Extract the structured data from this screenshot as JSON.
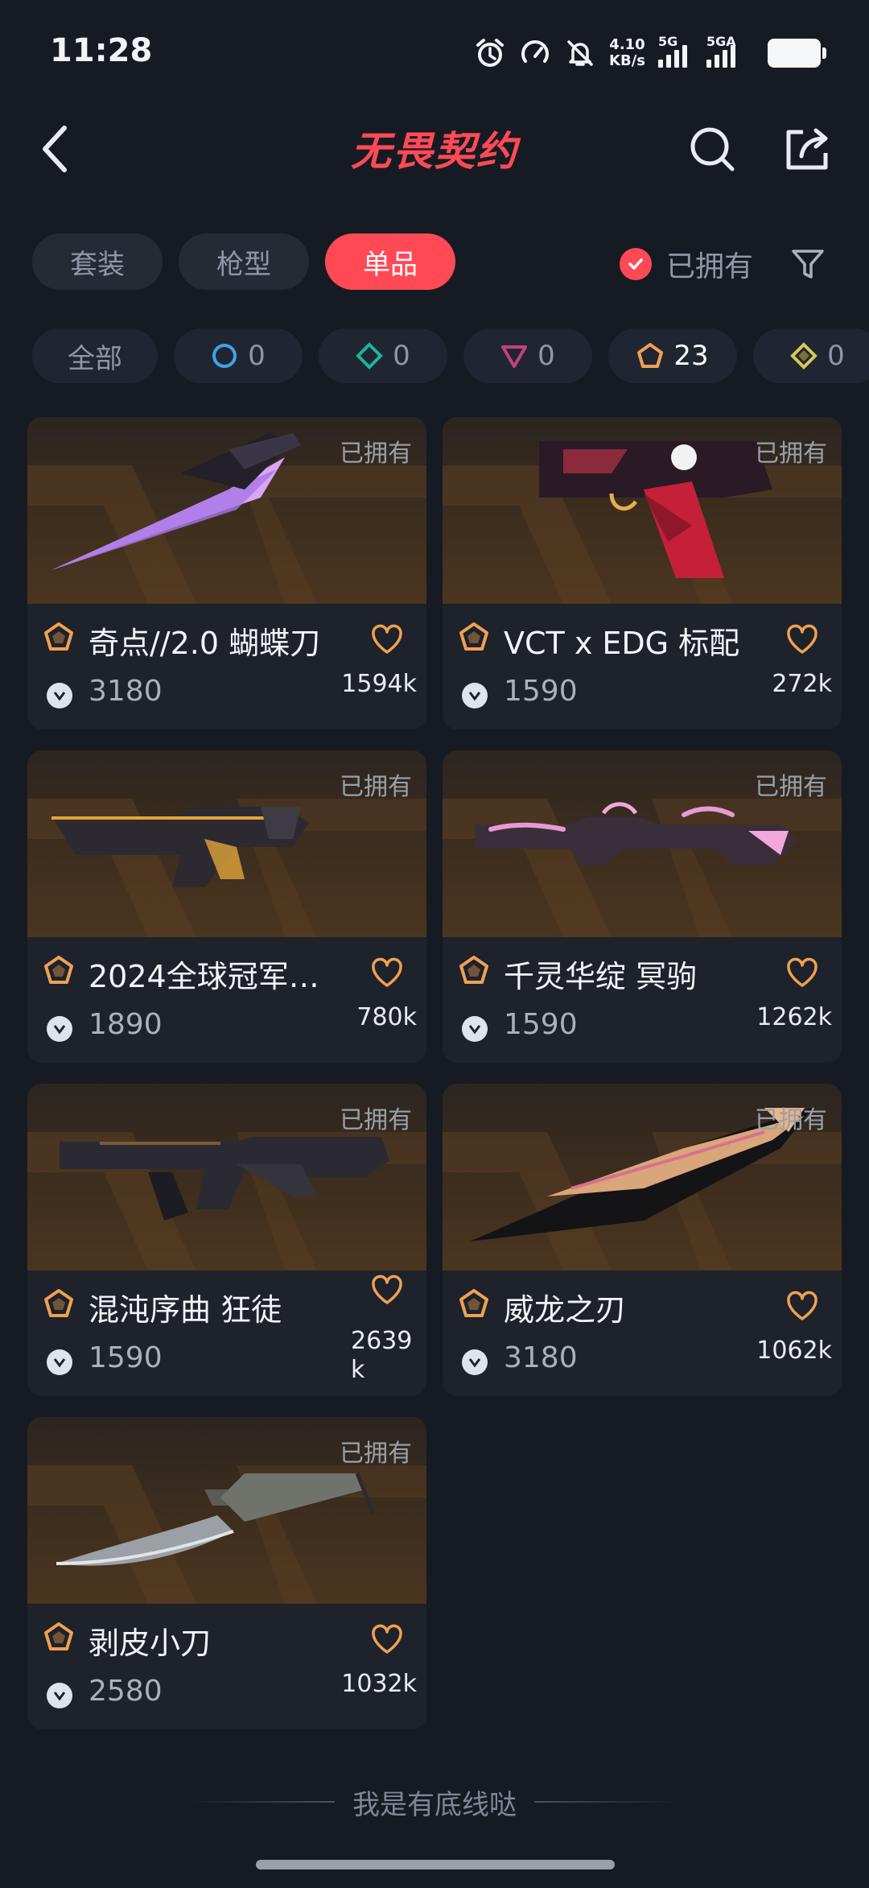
{
  "status_bar": {
    "time": "11:28",
    "net_speed_value": "4.10",
    "net_speed_unit": "KB/s",
    "sim1_label": "5G",
    "sim2_label": "5GA",
    "icons": [
      "alarm-icon",
      "speedometer-icon",
      "bell-muted-icon",
      "signal-icon",
      "battery-icon"
    ]
  },
  "header": {
    "title": "无畏契约",
    "back_icon": "chevron-left-icon",
    "search_icon": "search-icon",
    "share_icon": "share-icon"
  },
  "tabs": [
    {
      "label": "套装",
      "active": false
    },
    {
      "label": "枪型",
      "active": false
    },
    {
      "label": "单品",
      "active": true
    }
  ],
  "owned_filter": {
    "label": "已拥有",
    "checked": true
  },
  "filter_icon": "funnel-icon",
  "tiers": [
    {
      "label": "全部",
      "icon": ""
    },
    {
      "label": "0",
      "icon": "select-tier-icon",
      "color": "#3fa2e8"
    },
    {
      "label": "0",
      "icon": "deluxe-tier-icon",
      "color": "#1fb39b"
    },
    {
      "label": "0",
      "icon": "premium-tier-icon",
      "color": "#c0427e"
    },
    {
      "label": "23",
      "icon": "exclusive-tier-icon",
      "color": "#f0a052"
    },
    {
      "label": "0",
      "icon": "ultra-tier-icon",
      "color": "#d6c85a"
    }
  ],
  "items": [
    {
      "owned": "已拥有",
      "name": "奇点//2.0 蝴蝶刀",
      "price": "3180",
      "likes": "1594k",
      "art": "knife-violet"
    },
    {
      "owned": "已拥有",
      "name": "VCT x EDG 标配",
      "price": "1590",
      "likes": "272k",
      "art": "pistol-red"
    },
    {
      "owned": "已拥有",
      "name": "2024全球冠军…",
      "price": "1890",
      "likes": "780k",
      "art": "rifle-gold"
    },
    {
      "owned": "已拥有",
      "name": "千灵华绽 冥驹",
      "price": "1590",
      "likes": "1262k",
      "art": "sniper-pink"
    },
    {
      "owned": "已拥有",
      "name": "混沌序曲 狂徒",
      "price": "1590",
      "likes": "2639k",
      "art": "rifle-dark"
    },
    {
      "owned": "已拥有",
      "name": "威龙之刃",
      "price": "3180",
      "likes": "1062k",
      "art": "blade-copper"
    },
    {
      "owned": "已拥有",
      "name": "剥皮小刀",
      "price": "2580",
      "likes": "1032k",
      "art": "knife-steel"
    }
  ],
  "footer": {
    "text": "我是有底线哒"
  },
  "colors": {
    "accent": "#ff4a56",
    "background": "#161b23",
    "card": "#1d222b",
    "tier_exclusive": "#f0a052"
  }
}
